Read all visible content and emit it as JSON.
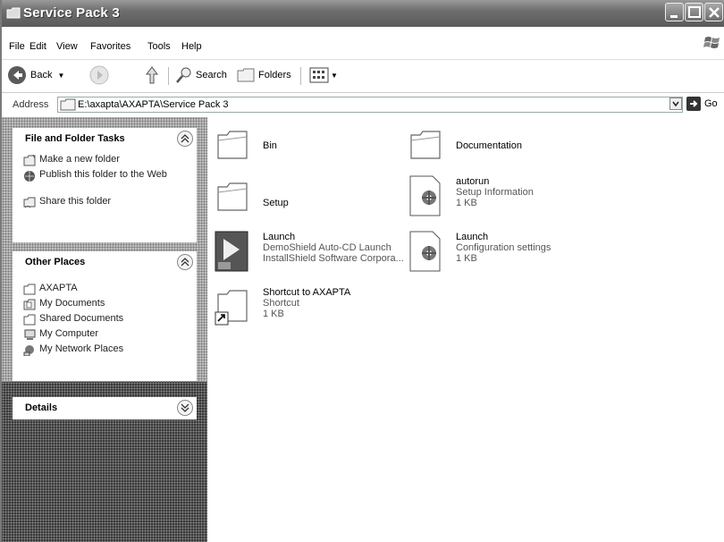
{
  "window": {
    "title": "Service Pack 3"
  },
  "menu": [
    "File",
    "Edit",
    "View",
    "Favorites",
    "Tools",
    "Help"
  ],
  "toolbar": {
    "back": "Back",
    "search": "Search",
    "folders": "Folders"
  },
  "address": {
    "label": "Address",
    "value": "E:\\axapta\\AXAPTA\\Service Pack 3",
    "go": "Go"
  },
  "tasks_panel": {
    "title": "File and Folder Tasks",
    "items": [
      "Make a new folder",
      "Publish this folder to the Web",
      "Share this folder"
    ]
  },
  "places_panel": {
    "title": "Other Places",
    "items": [
      "AXAPTA",
      "My Documents",
      "Shared Documents",
      "My Computer",
      "My Network Places"
    ]
  },
  "details_panel": {
    "title": "Details"
  },
  "files": [
    {
      "name": "Bin"
    },
    {
      "name": "Documentation"
    },
    {
      "name": "Setup"
    },
    {
      "name": "autorun",
      "line1": "Setup Information",
      "line2": "1 KB"
    },
    {
      "name": "Launch",
      "line1": "DemoShield Auto-CD Launch",
      "line2": "InstallShield Software Corpora..."
    },
    {
      "name": "Launch",
      "line1": "Configuration settings",
      "line2": "1 KB"
    },
    {
      "name": "Shortcut to AXAPTA",
      "line1": "Shortcut",
      "line2": "1 KB"
    }
  ]
}
